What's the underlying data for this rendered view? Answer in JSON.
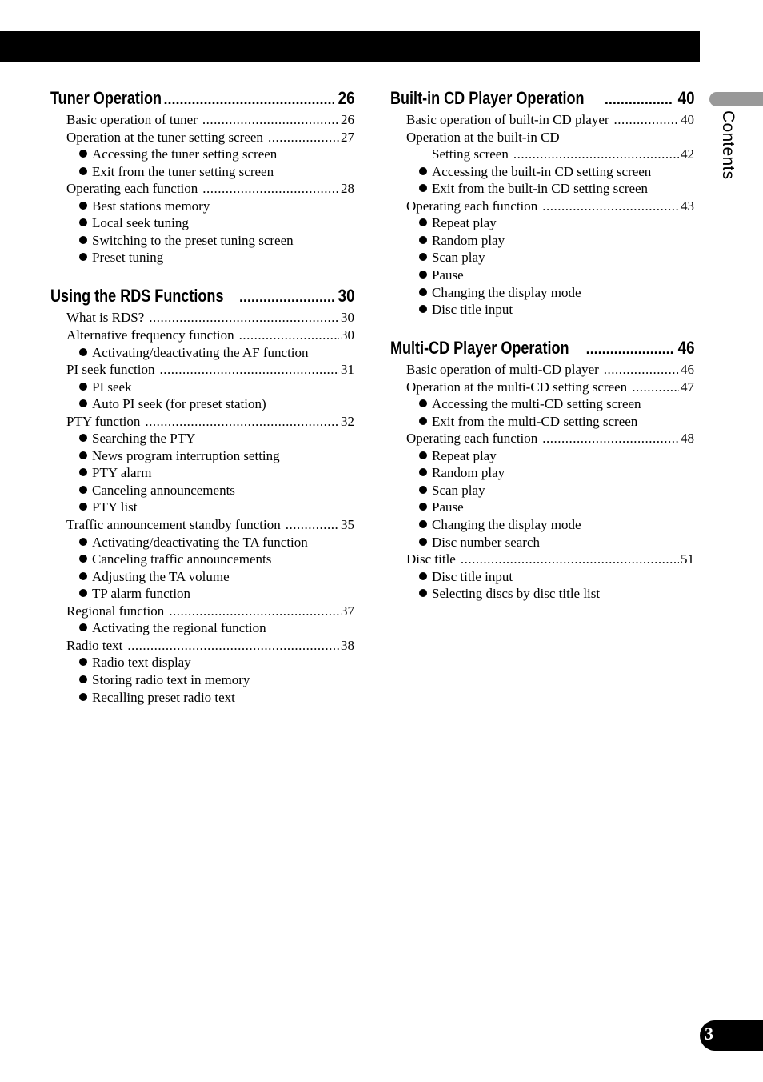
{
  "side_tab": {
    "label": "Contents"
  },
  "page_number": "3",
  "dot_leader": "..........................................................................................................",
  "columns": [
    {
      "sections": [
        {
          "title": "Tuner Operation",
          "page": "26",
          "entries": [
            {
              "type": "entry",
              "text": "Basic operation of tuner",
              "page": "26"
            },
            {
              "type": "entry",
              "text": "Operation at the tuner setting screen",
              "page": "27"
            },
            {
              "type": "bullet",
              "text": "Accessing the tuner setting screen"
            },
            {
              "type": "bullet",
              "text": "Exit from the tuner setting screen"
            },
            {
              "type": "entry",
              "text": "Operating each function",
              "page": "28"
            },
            {
              "type": "bullet",
              "text": "Best stations memory"
            },
            {
              "type": "bullet",
              "text": "Local seek tuning"
            },
            {
              "type": "bullet",
              "text": "Switching to the preset tuning screen"
            },
            {
              "type": "bullet",
              "text": "Preset tuning"
            }
          ]
        },
        {
          "title": "Using the RDS Functions",
          "page": "30",
          "entries": [
            {
              "type": "entry",
              "text": "What is RDS?",
              "page": "30"
            },
            {
              "type": "entry",
              "text": "Alternative frequency function",
              "page": "30"
            },
            {
              "type": "bullet",
              "text": "Activating/deactivating the AF function"
            },
            {
              "type": "entry",
              "text": "PI seek function",
              "page": "31"
            },
            {
              "type": "bullet",
              "text": "PI seek"
            },
            {
              "type": "bullet",
              "text": "Auto PI seek (for preset station)"
            },
            {
              "type": "entry",
              "text": "PTY function",
              "page": "32"
            },
            {
              "type": "bullet",
              "text": "Searching the PTY"
            },
            {
              "type": "bullet",
              "text": "News program interruption setting"
            },
            {
              "type": "bullet",
              "text": "PTY alarm"
            },
            {
              "type": "bullet",
              "text": "Canceling announcements"
            },
            {
              "type": "bullet",
              "text": "PTY list"
            },
            {
              "type": "entry",
              "text": "Traffic announcement standby function",
              "page": "35"
            },
            {
              "type": "bullet",
              "text": "Activating/deactivating the TA function"
            },
            {
              "type": "bullet",
              "text": "Canceling traffic announcements"
            },
            {
              "type": "bullet",
              "text": "Adjusting the TA volume"
            },
            {
              "type": "bullet",
              "text": "TP alarm function"
            },
            {
              "type": "entry",
              "text": "Regional function",
              "page": "37"
            },
            {
              "type": "bullet",
              "text": "Activating the regional function"
            },
            {
              "type": "entry",
              "text": "Radio text",
              "page": "38"
            },
            {
              "type": "bullet",
              "text": "Radio text display"
            },
            {
              "type": "bullet",
              "text": "Storing radio text in memory"
            },
            {
              "type": "bullet",
              "text": "Recalling preset radio text"
            }
          ]
        }
      ]
    },
    {
      "sections": [
        {
          "title": "Built-in CD Player Operation",
          "page": "40",
          "entries": [
            {
              "type": "entry",
              "text": "Basic operation of built-in CD player",
              "page": "40"
            },
            {
              "type": "entry_nopage",
              "text": "Operation at the built-in CD"
            },
            {
              "type": "continuation",
              "text": "Setting screen",
              "page": "42"
            },
            {
              "type": "bullet",
              "text": "Accessing the built-in CD setting screen"
            },
            {
              "type": "bullet",
              "text": "Exit from the built-in CD setting screen"
            },
            {
              "type": "entry",
              "text": "Operating each function",
              "page": "43"
            },
            {
              "type": "bullet",
              "text": "Repeat play"
            },
            {
              "type": "bullet",
              "text": "Random play"
            },
            {
              "type": "bullet",
              "text": "Scan play"
            },
            {
              "type": "bullet",
              "text": "Pause"
            },
            {
              "type": "bullet",
              "text": "Changing the display mode"
            },
            {
              "type": "bullet",
              "text": "Disc title input"
            }
          ]
        },
        {
          "title": "Multi-CD Player Operation",
          "page": "46",
          "entries": [
            {
              "type": "entry",
              "text": "Basic operation of multi-CD player",
              "page": "46"
            },
            {
              "type": "entry",
              "text": "Operation at the multi-CD setting screen",
              "page": "47"
            },
            {
              "type": "bullet",
              "text": "Accessing the multi-CD setting screen"
            },
            {
              "type": "bullet",
              "text": "Exit from the multi-CD setting screen"
            },
            {
              "type": "entry",
              "text": "Operating each function",
              "page": "48"
            },
            {
              "type": "bullet",
              "text": "Repeat play"
            },
            {
              "type": "bullet",
              "text": "Random play"
            },
            {
              "type": "bullet",
              "text": "Scan play"
            },
            {
              "type": "bullet",
              "text": "Pause"
            },
            {
              "type": "bullet",
              "text": "Changing the display mode"
            },
            {
              "type": "bullet",
              "text": "Disc number search"
            },
            {
              "type": "entry",
              "text": "Disc title",
              "page": "51"
            },
            {
              "type": "bullet",
              "text": "Disc title input"
            },
            {
              "type": "bullet",
              "text": "Selecting discs by disc title list"
            }
          ]
        }
      ]
    }
  ]
}
